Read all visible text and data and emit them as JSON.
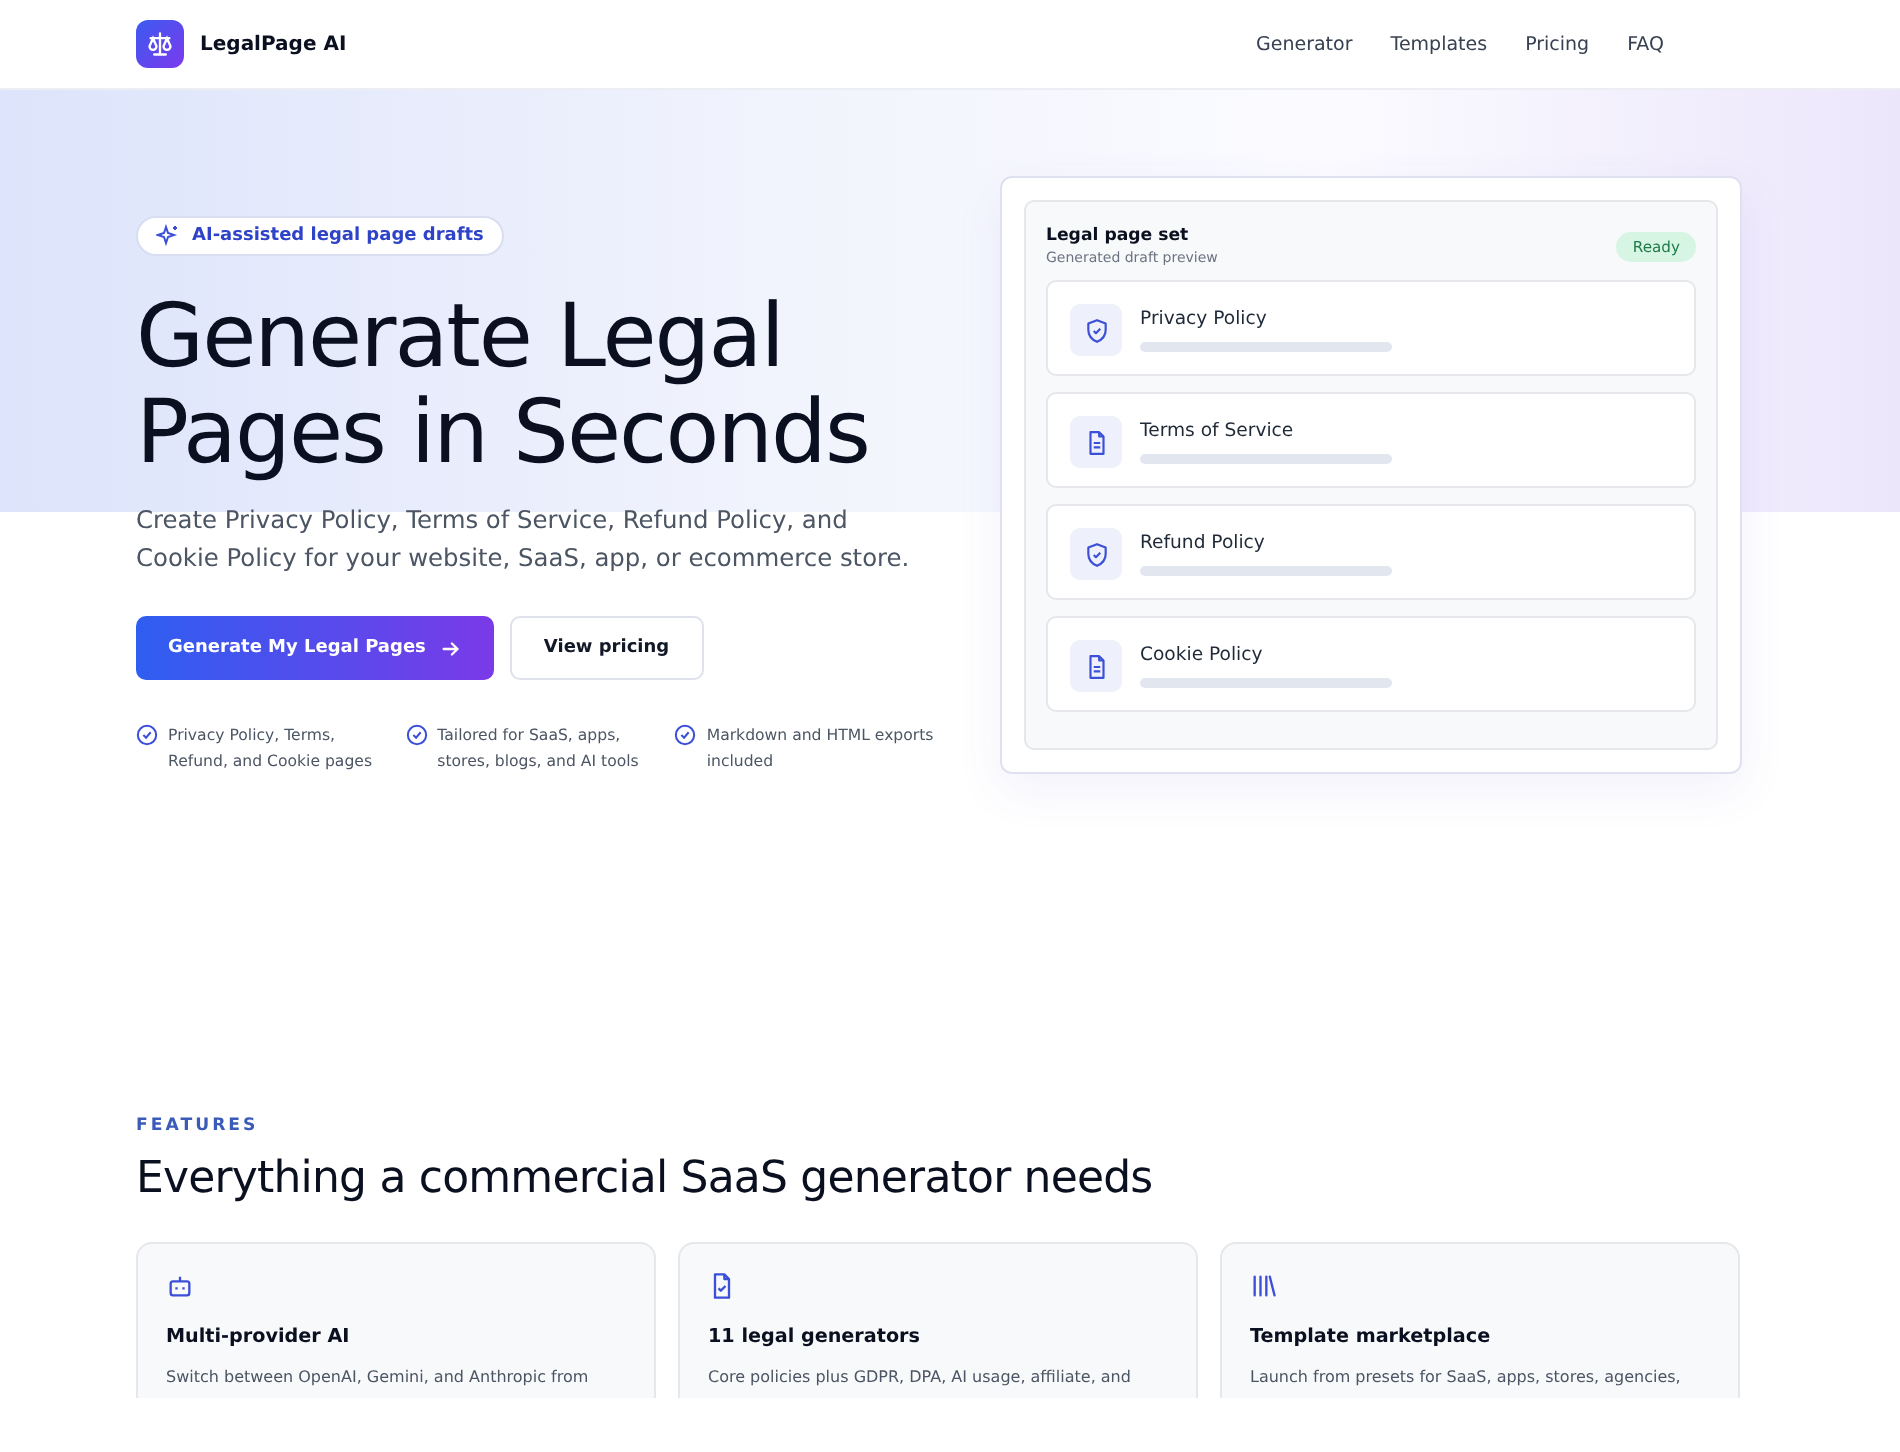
{
  "brand": {
    "name": "LegalPage AI"
  },
  "nav": [
    {
      "label": "Generator"
    },
    {
      "label": "Templates"
    },
    {
      "label": "Pricing"
    },
    {
      "label": "FAQ"
    }
  ],
  "hero": {
    "badge": "AI-assisted legal page drafts",
    "title_lines": [
      "Generate Legal",
      "Pages in Seconds"
    ],
    "subtitle": "Create Privacy Policy, Terms of Service, Refund Policy, and Cookie Policy for your website, SaaS, app, or ecommerce store.",
    "primary_button": "Generate My Legal Pages",
    "secondary_button": "View pricing",
    "highlights": [
      "Privacy Policy, Terms, Refund, and Cookie pages",
      "Tailored for SaaS, apps, stores, blogs, and AI tools",
      "Markdown and HTML exports included"
    ]
  },
  "preview": {
    "title": "Legal page set",
    "subtitle": "Generated draft preview",
    "status": "Ready",
    "pages": [
      {
        "name": "Privacy Policy",
        "kind": "shield"
      },
      {
        "name": "Terms of Service",
        "kind": "document"
      },
      {
        "name": "Refund Policy",
        "kind": "shield"
      },
      {
        "name": "Cookie Policy",
        "kind": "document"
      }
    ]
  },
  "features": {
    "eyebrow": "FEATURES",
    "title": "Everything a commercial SaaS generator needs",
    "cards": [
      {
        "title": "Multi-provider AI",
        "text": "Switch between OpenAI, Gemini, and Anthropic from",
        "kind": "robot"
      },
      {
        "title": "11 legal generators",
        "text": "Core policies plus GDPR, DPA, AI usage, affiliate, and",
        "kind": "file-check"
      },
      {
        "title": "Template marketplace",
        "text": "Launch from presets for SaaS, apps, stores, agencies,",
        "kind": "library"
      }
    ]
  }
}
